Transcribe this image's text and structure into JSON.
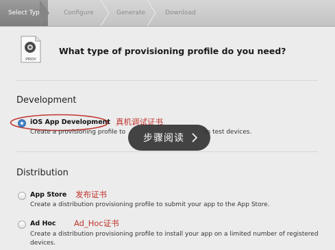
{
  "steps": [
    "Select Type",
    "Configure",
    "Generate",
    "Download"
  ],
  "header": {
    "icon_label": "PROV",
    "question": "What type of provisioning profile do you need?"
  },
  "development": {
    "title": "Development",
    "option": {
      "label": "iOS App Development",
      "description_visible": "Create a provisioning profile to",
      "description_end": "on test devices.",
      "annotation": "真机调试证书",
      "selected": true
    }
  },
  "distribution": {
    "title": "Distribution",
    "options": [
      {
        "label": "App Store",
        "annotation": "发布证书",
        "description": "Create a distribution provisioning profile to submit your app to the App Store.",
        "selected": false
      },
      {
        "label": "Ad Hoc",
        "annotation": "Ad_Hoc证书",
        "description": "Create a distribution provisioning profile to install your app on a limited number of registered",
        "description_line2": "devices.",
        "selected": false
      }
    ]
  },
  "overlay": {
    "label": "步骤阅读"
  },
  "colors": {
    "annotation": "#c0342c",
    "radio_selected": "#2f6fb3",
    "background": "#ececec"
  }
}
